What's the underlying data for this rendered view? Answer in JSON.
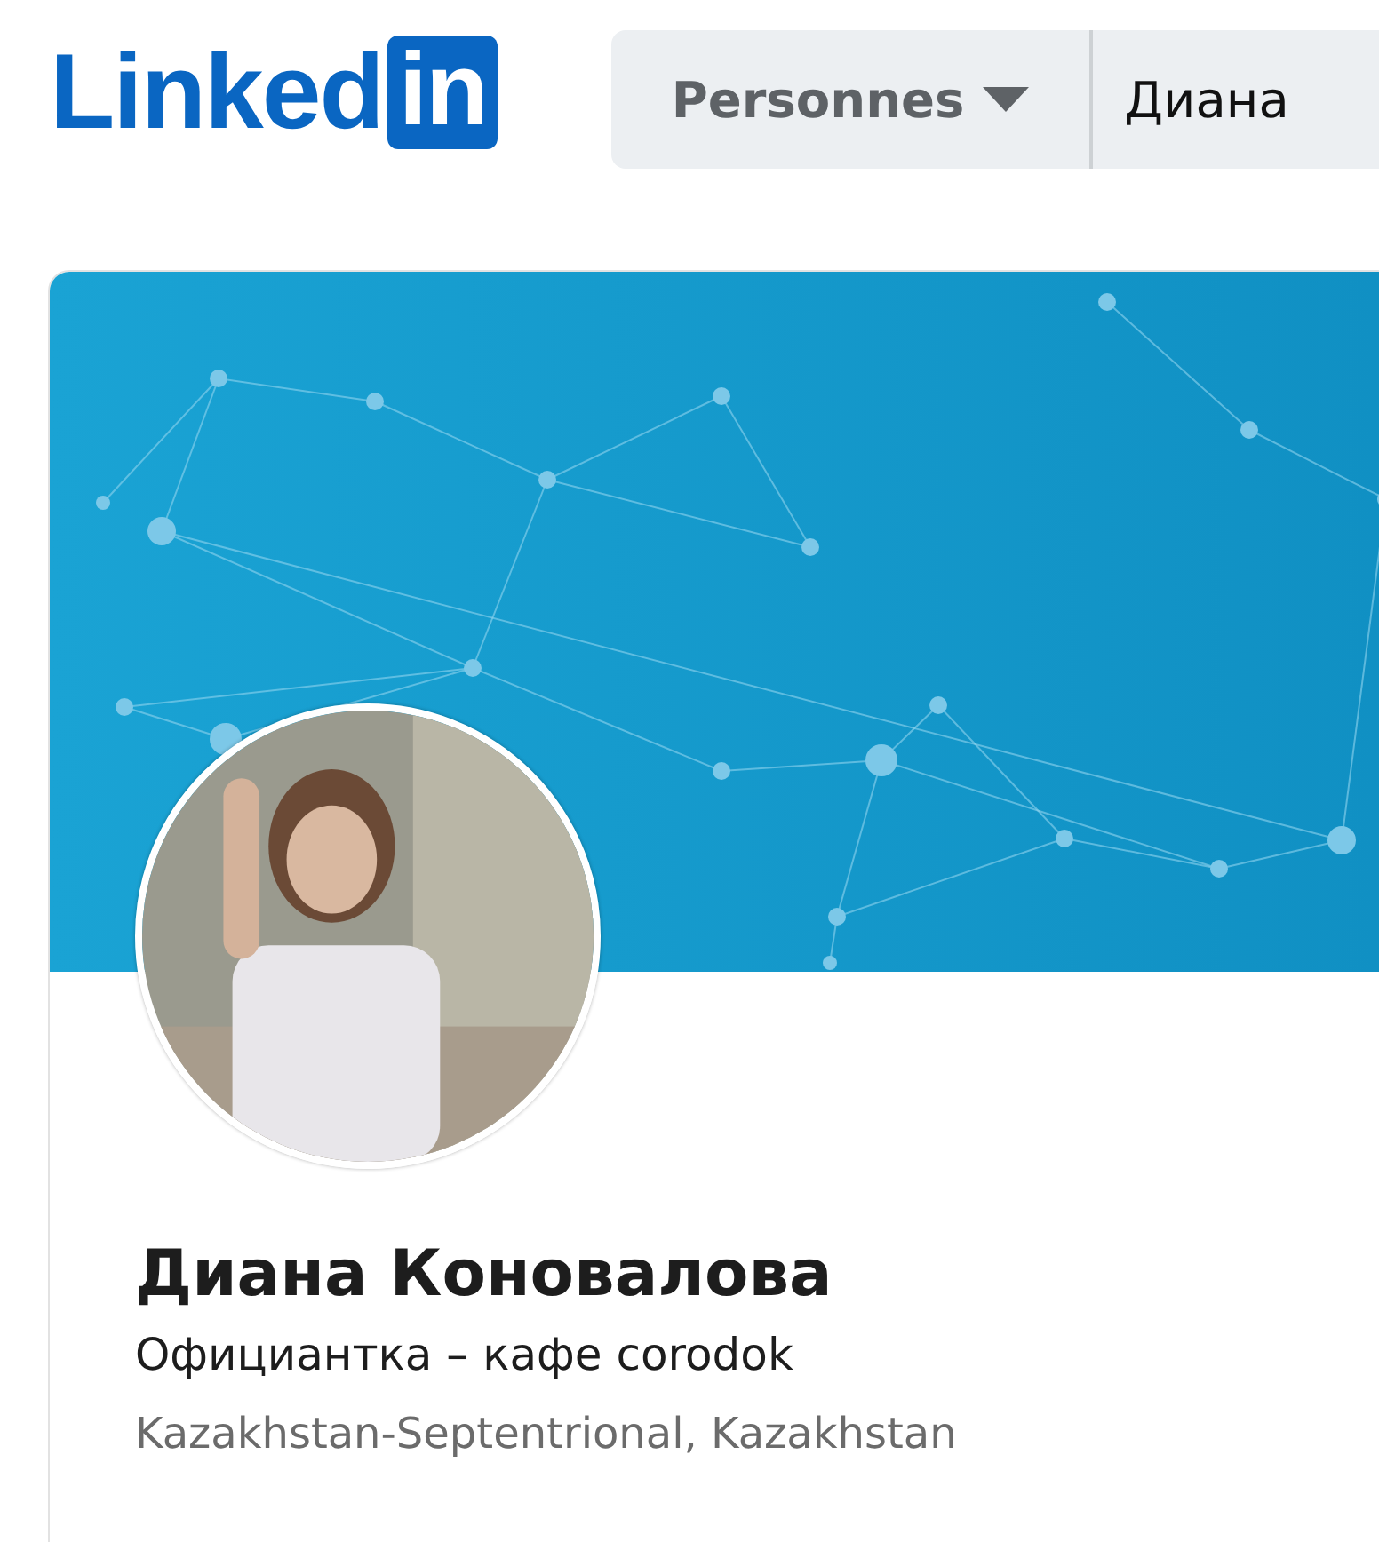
{
  "header": {
    "logo": {
      "word": "Linked",
      "badge": "in"
    },
    "search": {
      "category": "Personnes",
      "value": "Диана"
    }
  },
  "profile": {
    "name": "Диана Коновалова",
    "headline": "Официантка – кафе corodok",
    "location": "Kazakhstan-Septentrional, Kazakhstan"
  }
}
